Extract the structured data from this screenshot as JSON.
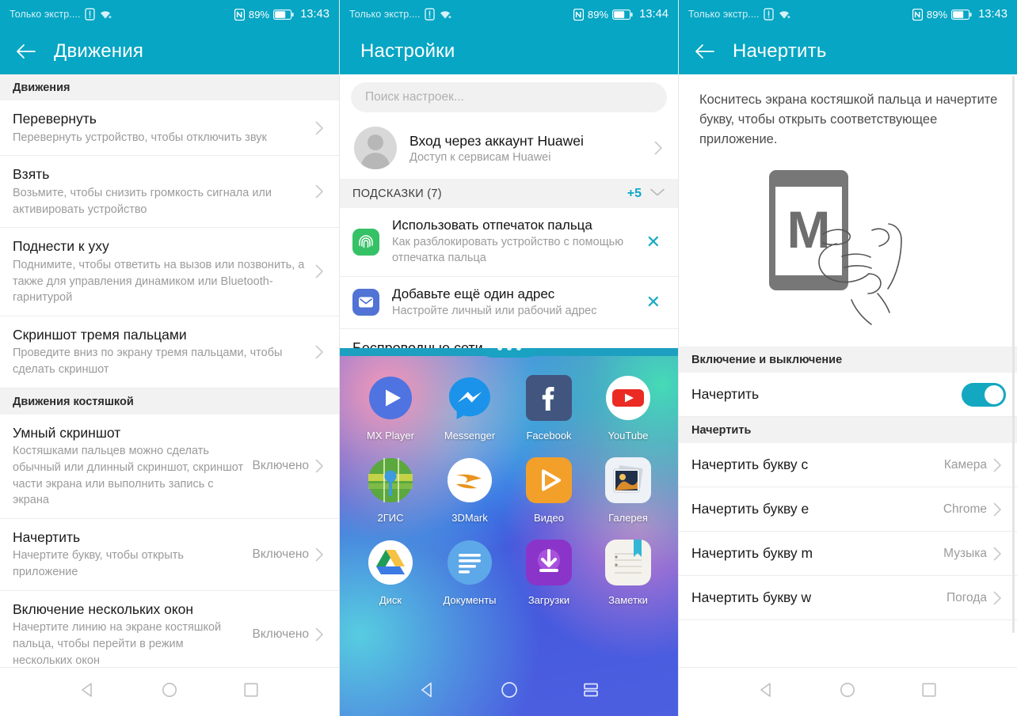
{
  "statusbar": {
    "carrier": "Только экстр....",
    "battery_pct": "89%",
    "time_left": "13:43",
    "time_mid": "13:44",
    "time_right": "13:43",
    "nfc_icon": "nfc-icon",
    "sim_icon": "sim-alert-icon",
    "wifi_icon": "wifi-icon",
    "battery_icon": "battery-icon"
  },
  "panel1": {
    "title": "Движения",
    "back_icon": "back-arrow-icon",
    "sections": [
      {
        "header": "Движения",
        "rows": [
          {
            "title": "Перевернуть",
            "sub": "Перевернуть устройство, чтобы отключить звук",
            "value": ""
          },
          {
            "title": "Взять",
            "sub": "Возьмите, чтобы снизить громкость сигнала или активировать устройство",
            "value": ""
          },
          {
            "title": "Поднести к уху",
            "sub": "Поднимите, чтобы ответить на вызов или позвонить, а также для управления динамиком или Bluetooth-гарнитурой",
            "value": ""
          },
          {
            "title": "Скриншот тремя пальцами",
            "sub": "Проведите вниз по экрану тремя пальцами, чтобы сделать скриншот",
            "value": ""
          }
        ]
      },
      {
        "header": "Движения костяшкой",
        "rows": [
          {
            "title": "Умный скриншот",
            "sub": "Костяшками пальцев можно сделать обычный или длинный скриншот, скриншот части экрана или выполнить запись с экрана",
            "value": "Включено"
          },
          {
            "title": "Начертить",
            "sub": "Начертите букву, чтобы открыть приложение",
            "value": "Включено"
          },
          {
            "title": "Включение нескольких окон",
            "sub": "Начертите линию на экране костяшкой пальца, чтобы перейти в режим нескольких окон",
            "value": "Включено"
          }
        ]
      }
    ]
  },
  "panel2": {
    "title": "Настройки",
    "search_placeholder": "Поиск настроек...",
    "account": {
      "title": "Вход через аккаунт Huawei",
      "sub": "Доступ к сервисам Huawei",
      "avatar_icon": "avatar-icon"
    },
    "tips": {
      "header": "ПОДСКАЗКИ (7)",
      "plus": "+5",
      "collapse_icon": "chevron-down-icon",
      "items": [
        {
          "title": "Использовать отпечаток пальца",
          "sub": "Как разблокировать устройство с помощью отпечатка пальца",
          "icon": "fingerprint-icon",
          "close": "✕"
        },
        {
          "title": "Добавьте ещё один адрес",
          "sub": "Настройте личный или рабочий адрес",
          "icon": "mail-icon",
          "close": "✕"
        }
      ]
    },
    "next_section": "Беспроводные сети"
  },
  "drawer": {
    "handle_icon": "drawer-handle-dots",
    "apps": [
      {
        "label": "MX Player",
        "icon": "mx-player-icon"
      },
      {
        "label": "Messenger",
        "icon": "messenger-icon"
      },
      {
        "label": "Facebook",
        "icon": "facebook-icon"
      },
      {
        "label": "YouTube",
        "icon": "youtube-icon"
      },
      {
        "label": "2ГИС",
        "icon": "2gis-icon"
      },
      {
        "label": "3DMark",
        "icon": "3dmark-icon"
      },
      {
        "label": "Видео",
        "icon": "video-icon"
      },
      {
        "label": "Галерея",
        "icon": "gallery-icon"
      },
      {
        "label": "Диск",
        "icon": "google-drive-icon"
      },
      {
        "label": "Документы",
        "icon": "google-docs-icon"
      },
      {
        "label": "Загрузки",
        "icon": "downloads-icon"
      },
      {
        "label": "Заметки",
        "icon": "notes-icon"
      }
    ]
  },
  "panel3": {
    "title": "Начертить",
    "back_icon": "back-arrow-icon",
    "description": "Коснитесь экрана костяшкой пальца и начертите букву, чтобы открыть соответствующее приложение.",
    "illustration_letter": "M",
    "illustration_icon": "knuckle-draw-illustration",
    "toggle_section_header": "Включение и выключение",
    "toggle_row_label": "Начертить",
    "toggle_state": "on",
    "letters_section_header": "Начертить",
    "letters": [
      {
        "title": "Начертить букву c",
        "value": "Камера"
      },
      {
        "title": "Начертить букву e",
        "value": "Chrome"
      },
      {
        "title": "Начертить букву m",
        "value": "Музыка"
      },
      {
        "title": "Начертить букву w",
        "value": "Погода"
      }
    ]
  },
  "navbar": {
    "back": "nav-back-icon",
    "home": "nav-home-icon",
    "recents": "nav-recents-icon",
    "recents_drawer": "nav-recents-split-icon"
  },
  "colors": {
    "accent_teal": "#06a6c4",
    "toggle_on": "#13a8c0",
    "tip_close": "#17a9c4",
    "plus_badge": "#0aa8c6"
  }
}
